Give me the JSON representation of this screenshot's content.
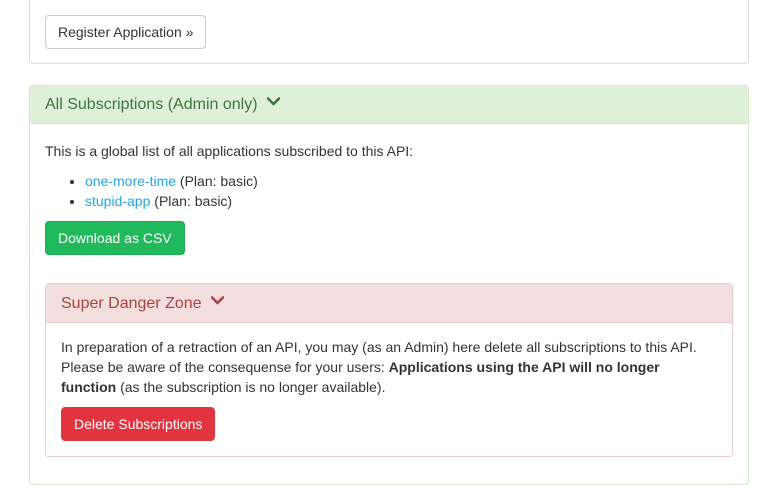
{
  "applications_panel": {
    "register_button": "Register Application »"
  },
  "subscriptions_panel": {
    "title": "All Subscriptions (Admin only)",
    "title_icon": "chevron-down-icon",
    "intro": "This is a global list of all applications subscribed to this API:",
    "subscriptions": [
      {
        "app": "one-more-time",
        "plan": "(Plan: basic)"
      },
      {
        "app": "stupid-app",
        "plan": "(Plan: basic)"
      }
    ],
    "download_button": "Download as CSV",
    "colors": {
      "heading_bg": "#dff0d8",
      "heading_text": "#3c763d",
      "button": "#20b95b",
      "link": "#1fa7e1"
    }
  },
  "danger_zone": {
    "title": "Super Danger Zone",
    "title_icon": "chevron-down-icon",
    "text_before": "In preparation of a retraction of an API, you may (as an Admin) here delete all subscriptions to this API. Please be aware of the consequense for your users: ",
    "text_bold": "Applications using the API will no longer function",
    "text_after": " (as the subscription is no longer available).",
    "delete_button": "Delete Subscriptions",
    "colors": {
      "heading_bg": "#f2dede",
      "heading_text": "#a94442",
      "button": "#e2343e"
    }
  }
}
